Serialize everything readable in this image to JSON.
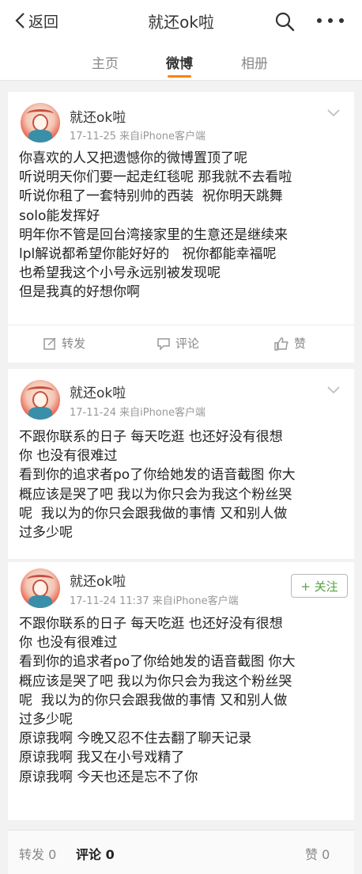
{
  "nav": {
    "back_label": "返回",
    "title": "就还ok啦"
  },
  "tabs": [
    {
      "label": "主页",
      "active": false
    },
    {
      "label": "微博",
      "active": true
    },
    {
      "label": "相册",
      "active": false
    }
  ],
  "posts": [
    {
      "username": "就还ok啦",
      "meta": "17-11-25 来自iPhone客户端",
      "text": "你喜欢的人又把遗憾你的微博置顶了呢\n听说明天你们要一起走红毯呢 那我就不去看啦\n听说你租了一套特别帅的西装  祝你明天跳舞\nsolo能发挥好\n明年你不管是回台湾接家里的生意还是继续来\nlpl解说都希望你能好好的   祝你都能幸福呢\n也希望我这个小号永远别被发现呢\n但是我真的好想你啊",
      "actions": {
        "repost": "转发",
        "comment": "评论",
        "like": "赞"
      }
    },
    {
      "username": "就还ok啦",
      "meta": "17-11-24 来自iPhone客户端",
      "text": "不跟你联系的日子 每天吃逛 也还好没有很想\n你 也没有很难过\n看到你的追求者po了你给她发的语音截图 你大\n概应该是哭了吧 我以为你只会为我这个粉丝哭\n呢  我以为的你只会跟我做的事情 又和别人做\n过多少呢"
    },
    {
      "username": "就还ok啦",
      "meta": "17-11-24 11:37 来自iPhone客户端",
      "follow_label": "+ 关注",
      "text": "不跟你联系的日子 每天吃逛 也还好没有很想\n你 也没有很难过\n看到你的追求者po了你给她发的语音截图 你大\n概应该是哭了吧 我以为你只会为我这个粉丝哭\n呢  我以为的你只会跟我做的事情 又和别人做\n过多少呢\n原谅我啊 今晚又忍不住去翻了聊天记录\n原谅我啊 我又在小号戏精了\n原谅我啊 今天也还是忘不了你"
    }
  ],
  "bottom_bar": {
    "repost": "转发 0",
    "comment": "评论 0",
    "like": "赞 0"
  },
  "colors": {
    "accent": "#ff8200",
    "follow_green": "#52a43b"
  }
}
